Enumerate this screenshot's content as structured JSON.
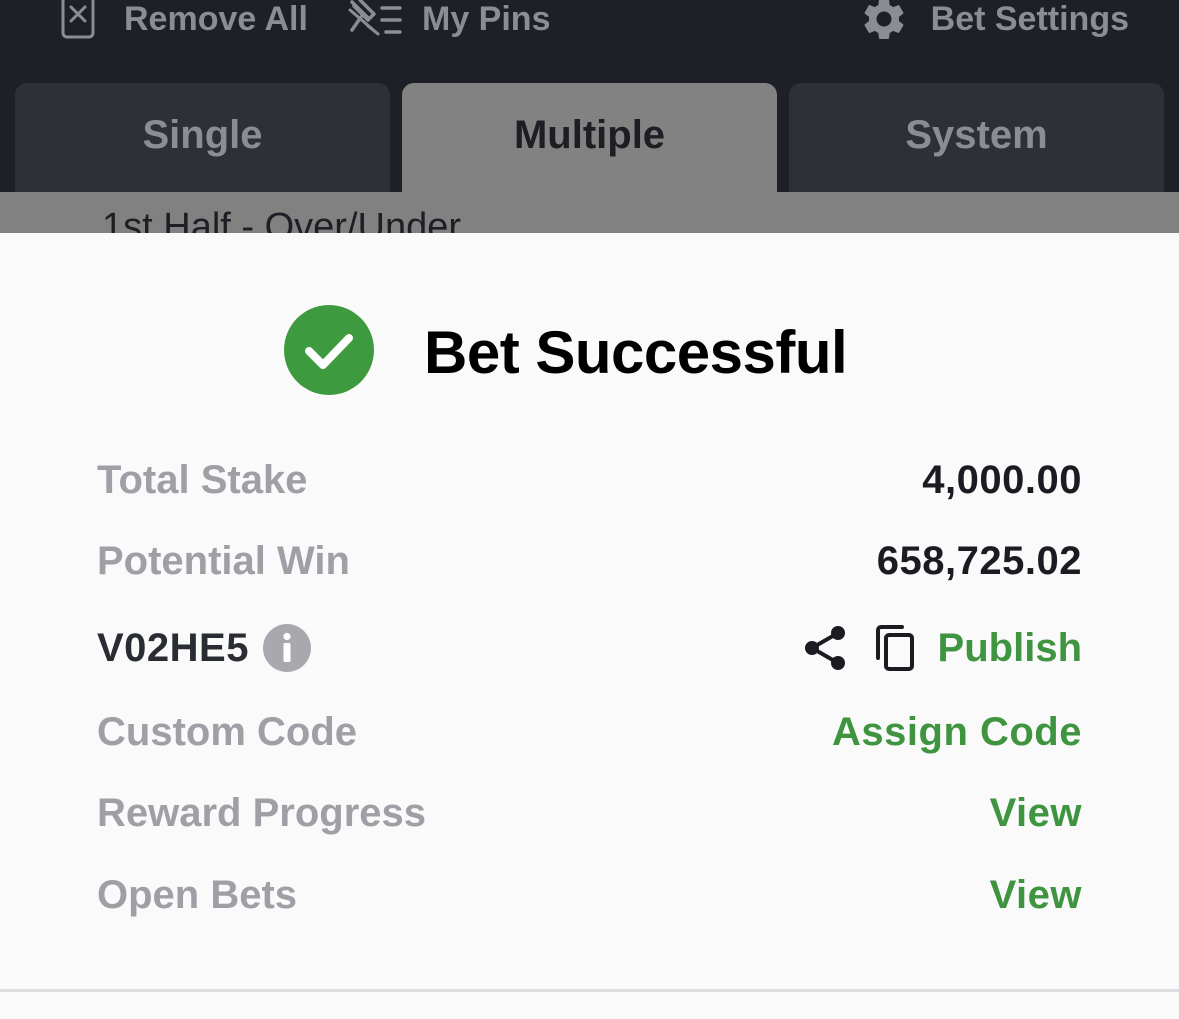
{
  "toolbar": {
    "remove_all": "Remove All",
    "my_pins": "My Pins",
    "bet_settings": "Bet Settings"
  },
  "tabs": [
    {
      "label": "Single",
      "active": false
    },
    {
      "label": "Multiple",
      "active": true
    },
    {
      "label": "System",
      "active": false
    }
  ],
  "peek_text": "1st Half - Over/Under",
  "result": {
    "title": "Bet Successful",
    "total_stake_label": "Total Stake",
    "total_stake_value": "4,000.00",
    "potential_win_label": "Potential Win",
    "potential_win_value": "658,725.02",
    "booking_code": "V02HE5",
    "publish_label": "Publish",
    "custom_code_label": "Custom Code",
    "assign_code_label": "Assign Code",
    "reward_progress_label": "Reward Progress",
    "reward_progress_action": "View",
    "open_bets_label": "Open Bets",
    "open_bets_action": "View"
  },
  "icons": {
    "remove_all": "close-box-icon",
    "my_pins": "unpin-list-icon",
    "bet_settings": "gear-icon",
    "success": "check-circle-icon",
    "info": "info-icon",
    "share": "share-icon",
    "copy": "copy-icon"
  },
  "colors": {
    "toolbar_bg": "#1e2027",
    "tab_bg": "#2e3038",
    "tab_active_bg": "#828282",
    "success_green": "#3d9a3e",
    "action_green": "#3f9440",
    "label_gray": "#9ea0a6"
  }
}
